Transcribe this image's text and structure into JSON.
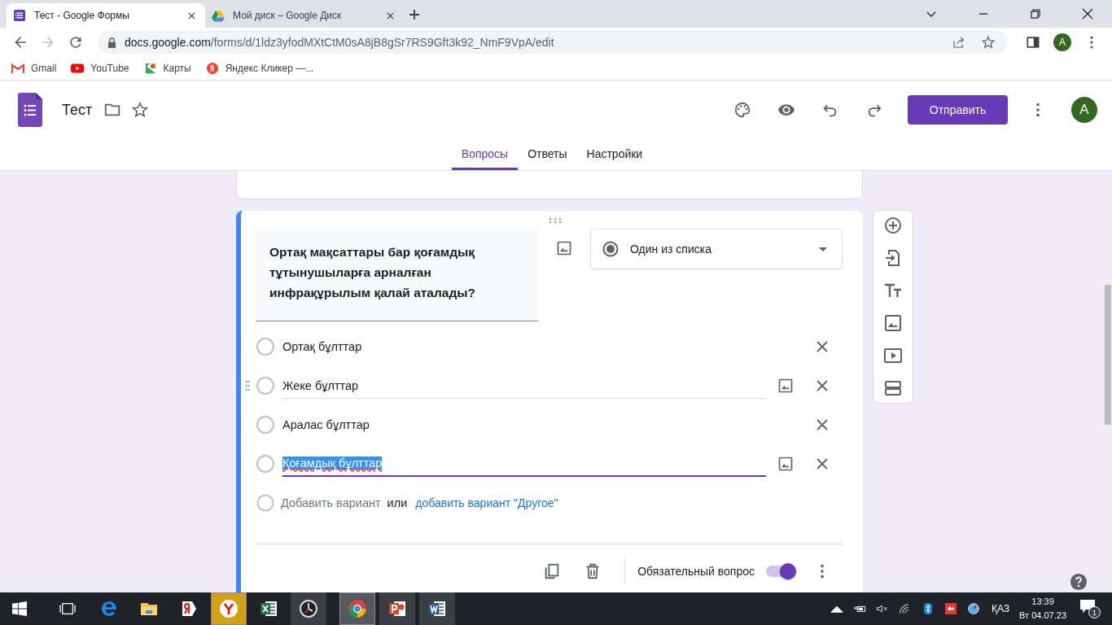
{
  "browser": {
    "tabs": [
      {
        "title": "Тест - Google Формы",
        "kind": "forms",
        "selected": true
      },
      {
        "title": "Мой диск – Google Диск",
        "kind": "drive",
        "selected": false
      }
    ],
    "url": {
      "host": "docs.google.com",
      "path": "/forms/d/1ldz3yfodMXtCtM0sA8jB8gSr7RS9Gft3k92_NmF9VpA/edit"
    },
    "profile": "A",
    "bookmarks": [
      {
        "label": "Gmail",
        "kind": "gmail"
      },
      {
        "label": "YouTube",
        "kind": "youtube"
      },
      {
        "label": "Карты",
        "kind": "maps"
      },
      {
        "label": "Яндекс Кликер —...",
        "kind": "yandex"
      }
    ]
  },
  "form": {
    "title": "Тест",
    "send": "Отправить",
    "avatar": "A",
    "tabs": [
      {
        "label": "Вопросы",
        "selected": true
      },
      {
        "label": "Ответы",
        "selected": false
      },
      {
        "label": "Настройки",
        "selected": false
      }
    ],
    "question": {
      "text": "Ортақ мақсаттары бар қоғамдық тұтынушыларға арналған инфрақұрылым қалай аталады?",
      "type": "Один из списка",
      "options": [
        {
          "text": "Ортақ бұлттар",
          "selected": false,
          "hovered": false,
          "focused": false
        },
        {
          "text": "Жеке бұлттар",
          "selected": false,
          "hovered": true,
          "focused": false
        },
        {
          "text": "Аралас бұлттар",
          "selected": false,
          "hovered": false,
          "focused": false
        },
        {
          "text": "Қоғамдық бұлттар",
          "selected": false,
          "hovered": false,
          "focused": true
        }
      ],
      "add_option": "Добавить вариант",
      "or": "или",
      "add_other": "добавить вариант \"Другое\"",
      "required_label": "Обязательный вопрос",
      "required": true
    }
  },
  "taskbar": {
    "apps": [
      {
        "kind": "edge",
        "open": false,
        "selected": false
      },
      {
        "kind": "explorer",
        "open": false,
        "selected": false
      },
      {
        "kind": "yandex-browser",
        "open": false,
        "selected": false
      },
      {
        "kind": "yandex",
        "open": true,
        "selected": true
      },
      {
        "kind": "excel",
        "open": false,
        "selected": false
      },
      {
        "kind": "clock",
        "open": true,
        "selected": false
      },
      {
        "kind": "chrome",
        "open": true,
        "selected": true
      },
      {
        "kind": "powerpoint",
        "open": true,
        "selected": false
      },
      {
        "kind": "word",
        "open": true,
        "selected": false
      }
    ],
    "language": "ҚАЗ",
    "time": "13:39",
    "date": "Вт 04.07.23",
    "notifications": "1"
  }
}
